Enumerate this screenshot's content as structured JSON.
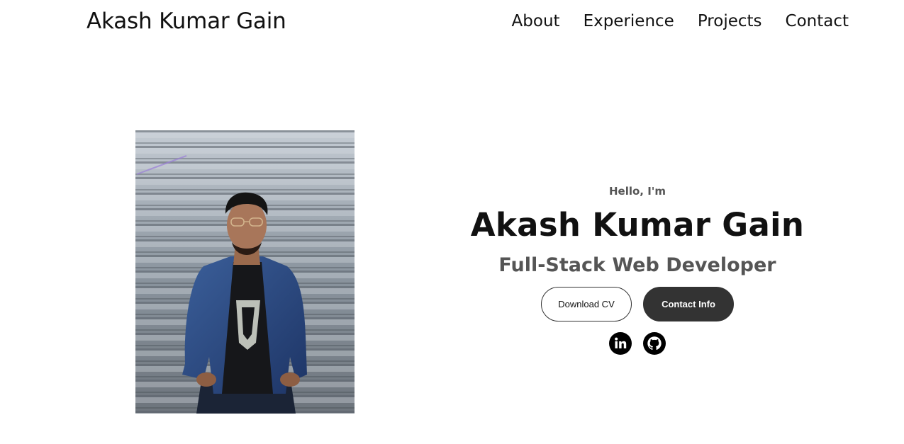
{
  "nav": {
    "logo": "Akash Kumar Gain",
    "links": [
      "About",
      "Experience",
      "Projects",
      "Contact"
    ]
  },
  "hero": {
    "greeting": "Hello, I'm",
    "name": "Akash Kumar Gain",
    "role": "Full-Stack Web Developer",
    "download_cv_label": "Download CV",
    "contact_info_label": "Contact Info"
  },
  "socials": {
    "icons": [
      "linkedin-icon",
      "github-icon"
    ]
  },
  "colors": {
    "text": "#111111",
    "muted": "#555555",
    "button_dark": "#333333",
    "background": "#ffffff"
  }
}
